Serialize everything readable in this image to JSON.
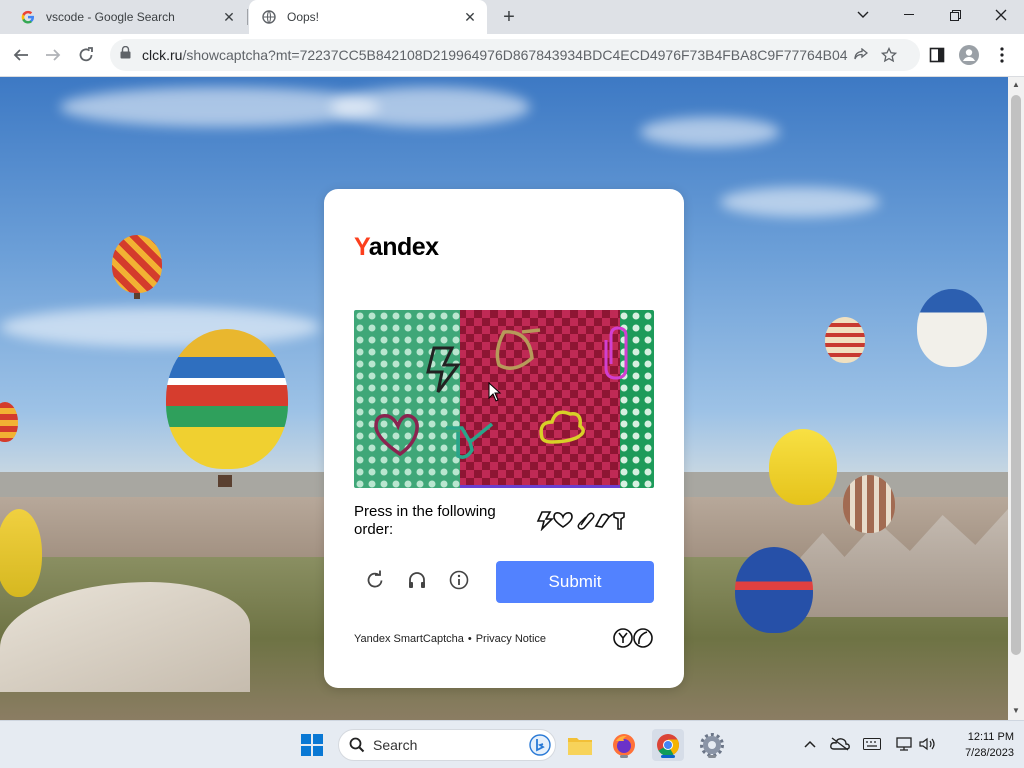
{
  "browser": {
    "tabs": [
      {
        "title": "vscode - Google Search",
        "favicon": "google-g-icon",
        "active": false
      },
      {
        "title": "Oops!",
        "favicon": "globe-icon",
        "active": true
      }
    ],
    "url_host": "clck.ru",
    "url_rest": "/showcaptcha?mt=72237CC5B842108D219964976D867843934BDC4ECD4976F73B4FBA8C9F77764B0485E..."
  },
  "captcha": {
    "logo_first": "Y",
    "logo_rest": "andex",
    "instruction": "Press in the following order:",
    "order_icons": [
      "lightning-icon",
      "heart-icon",
      "paperclip-icon",
      "bell-icon",
      "key-icon"
    ],
    "submit_label": "Submit",
    "footer_product": "Yandex SmartCaptcha",
    "footer_separator": "•",
    "footer_privacy": "Privacy Notice",
    "accent_color": "#5282ff",
    "logo_color": "#fc3f1d"
  },
  "taskbar": {
    "search_label": "Search",
    "apps": [
      "windows-start-icon",
      "search-icon",
      "bing-icon",
      "file-explorer-icon",
      "firefox-icon",
      "chrome-icon",
      "settings-icon"
    ],
    "time": "12:11 PM",
    "date": "7/28/2023"
  }
}
